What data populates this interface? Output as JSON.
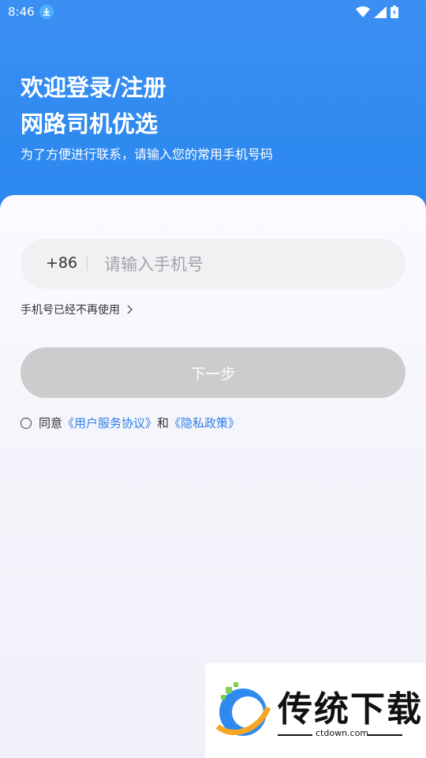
{
  "status_bar": {
    "time": "8:46",
    "icons": [
      "download-icon",
      "wifi-icon",
      "signal-icon",
      "battery-icon"
    ]
  },
  "header": {
    "title_line1": "欢迎登录/注册",
    "title_line2": "网路司机优选",
    "subtitle": "为了方便进行联系，请输入您的常用手机号码"
  },
  "form": {
    "country_code": "+86",
    "phone_placeholder": "请输入手机号",
    "phone_value": "",
    "no_longer_used": "手机号已经不再使用",
    "next_button": "下一步"
  },
  "agreement": {
    "prefix": "同意",
    "user_agreement": "《用户服务协议》",
    "and": "和",
    "privacy_policy": "《隐私政策》"
  },
  "watermark": {
    "brand": "传统下载",
    "url": "ctdown.com"
  },
  "colors": {
    "header_blue": "#2f8af0",
    "link_blue": "#2f7fe8",
    "button_disabled": "#cccccc"
  }
}
